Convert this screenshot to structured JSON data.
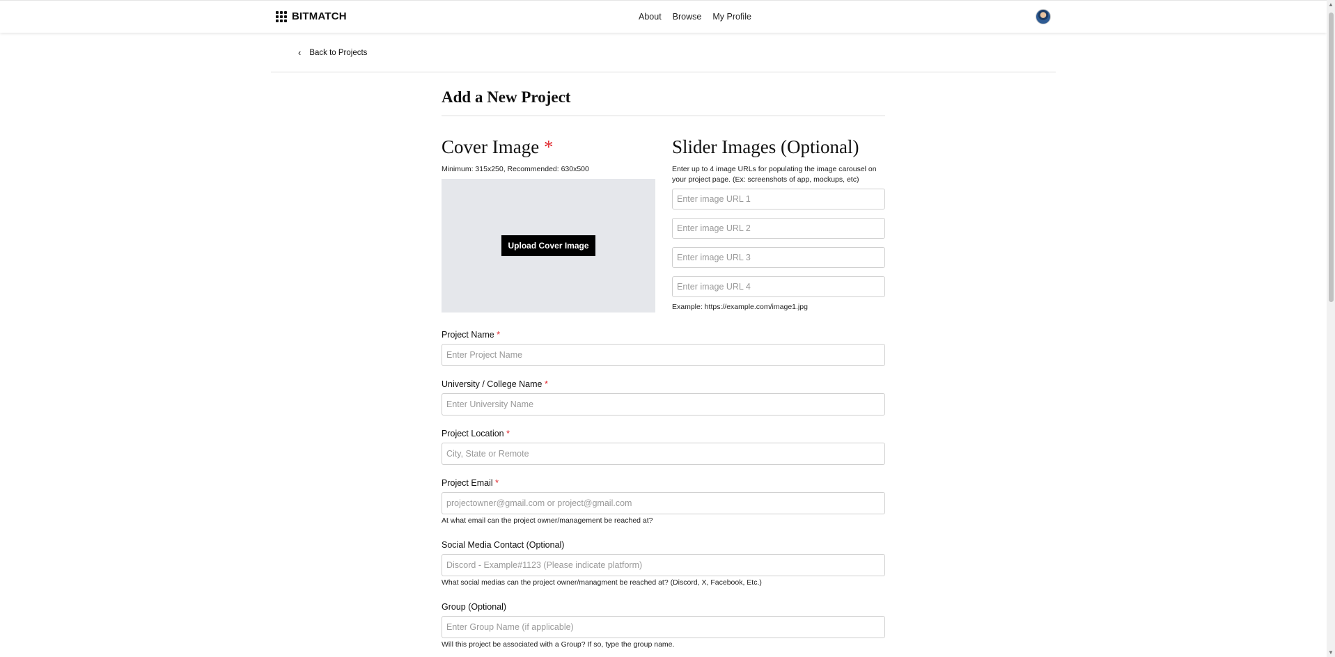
{
  "header": {
    "brand": "BITMATCH",
    "nav": [
      "About",
      "Browse",
      "My Profile"
    ]
  },
  "back_link": "Back to Projects",
  "page_title": "Add a New Project",
  "cover": {
    "heading": "Cover Image",
    "required_mark": "*",
    "hint": "Minimum: 315x250, Recommended: 630x500",
    "upload_button": "Upload Cover Image"
  },
  "slider": {
    "heading": "Slider Images (Optional)",
    "hint": "Enter up to 4 image URLs for populating the image carousel on your project page. (Ex: screenshots of app, mockups, etc)",
    "placeholders": [
      "Enter image URL 1",
      "Enter image URL 2",
      "Enter image URL 3",
      "Enter image URL 4"
    ],
    "example": "Example: https://example.com/image1.jpg"
  },
  "fields": {
    "project_name": {
      "label": "Project Name",
      "placeholder": "Enter Project Name"
    },
    "university": {
      "label": "University / College Name",
      "placeholder": "Enter University Name"
    },
    "location": {
      "label": "Project Location",
      "placeholder": "City, State or Remote"
    },
    "email": {
      "label": "Project Email",
      "placeholder": "projectowner@gmail.com or project@gmail.com",
      "help": "At what email can the project owner/management be reached at?"
    },
    "social": {
      "label": "Social Media Contact (Optional)",
      "placeholder": "Discord - Example#1123 (Please indicate platform)",
      "help": "What social medias can the project owner/managment be reached at? (Discord, X, Facebook, Etc.)"
    },
    "group": {
      "label": "Group (Optional)",
      "placeholder": "Enter Group Name (if applicable)",
      "help": "Will this project be associated with a Group? If so, type the group name."
    }
  },
  "required_mark": "*",
  "colors": {
    "required": "#e0282e",
    "cover_bg": "#e5e7eb",
    "button_bg": "#000000"
  }
}
